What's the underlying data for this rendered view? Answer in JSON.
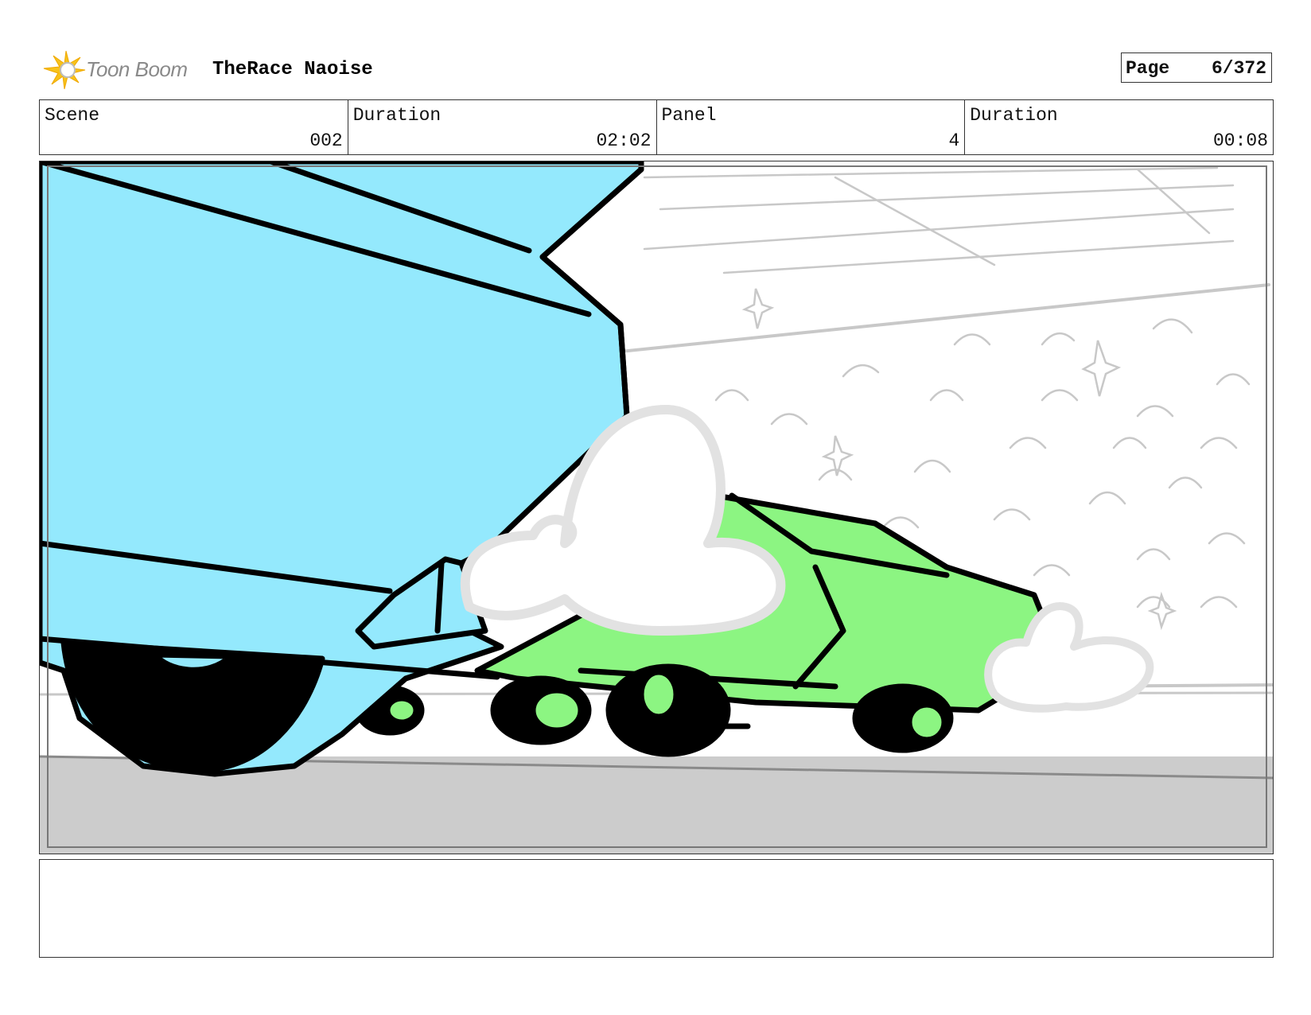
{
  "header": {
    "brand": "Toon Boom",
    "project_title": "TheRace Naoise",
    "page_label": "Page",
    "page_value": "6/372"
  },
  "info": {
    "scene_label": "Scene",
    "scene_value": "002",
    "scene_duration_label": "Duration",
    "scene_duration_value": "02:02",
    "panel_label": "Panel",
    "panel_value": "4",
    "panel_duration_label": "Duration",
    "panel_duration_value": "00:08"
  },
  "notes": {
    "text": ""
  },
  "colors": {
    "blue_car": "#94e9fd",
    "green_car": "#8cf582",
    "floor": "#cccccc",
    "outline": "#000000",
    "smoke_edge": "#e2e2e2",
    "sketch": "#c8c8c8",
    "logo_yellow": "#f7c21b"
  },
  "icons": {
    "logo": "toon-boom-star-icon"
  }
}
